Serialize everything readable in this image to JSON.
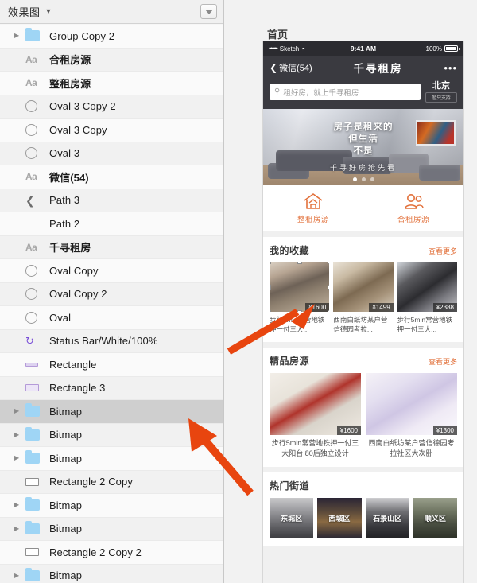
{
  "panel": {
    "title": "效果图",
    "chevron_icon": "chevron-down-icon",
    "filter_icon": "filter-dropdown-icon",
    "layers": [
      {
        "name": "Group Copy 2",
        "icon": "folder-icon",
        "arrow": true,
        "cjk": false
      },
      {
        "name": "合租房源",
        "icon": "text-icon",
        "arrow": false,
        "cjk": true
      },
      {
        "name": "整租房源",
        "icon": "text-icon",
        "arrow": false,
        "cjk": true
      },
      {
        "name": "Oval 3 Copy 2",
        "icon": "oval-icon",
        "arrow": false,
        "cjk": false
      },
      {
        "name": "Oval 3 Copy",
        "icon": "oval-icon",
        "arrow": false,
        "cjk": false
      },
      {
        "name": "Oval 3",
        "icon": "oval-icon",
        "arrow": false,
        "cjk": false
      },
      {
        "name": "微信(54)",
        "icon": "text-icon",
        "arrow": false,
        "cjk": true
      },
      {
        "name": "Path 3",
        "icon": "path-icon",
        "arrow": false,
        "cjk": false
      },
      {
        "name": "Path 2",
        "icon": "none",
        "arrow": false,
        "cjk": false
      },
      {
        "name": "千寻租房",
        "icon": "text-icon",
        "arrow": false,
        "cjk": true
      },
      {
        "name": "Oval Copy",
        "icon": "oval-icon",
        "arrow": false,
        "cjk": false
      },
      {
        "name": "Oval Copy 2",
        "icon": "oval-icon",
        "arrow": false,
        "cjk": false
      },
      {
        "name": "Oval",
        "icon": "oval-icon",
        "arrow": false,
        "cjk": false
      },
      {
        "name": "Status Bar/White/100%",
        "icon": "symbol-icon",
        "arrow": false,
        "cjk": false
      },
      {
        "name": "Rectangle",
        "icon": "rect-thin-icon",
        "arrow": false,
        "cjk": false
      },
      {
        "name": "Rectangle 3",
        "icon": "rect-mid-icon",
        "arrow": false,
        "cjk": false
      },
      {
        "name": "Bitmap",
        "icon": "folder-icon",
        "arrow": true,
        "cjk": false,
        "selected": true
      },
      {
        "name": "Bitmap",
        "icon": "folder-icon",
        "arrow": true,
        "cjk": false
      },
      {
        "name": "Bitmap",
        "icon": "folder-icon",
        "arrow": true,
        "cjk": false
      },
      {
        "name": "Rectangle 2 Copy",
        "icon": "rect-open-icon",
        "arrow": false,
        "cjk": false
      },
      {
        "name": "Bitmap",
        "icon": "folder-icon",
        "arrow": true,
        "cjk": false
      },
      {
        "name": "Bitmap",
        "icon": "folder-icon",
        "arrow": true,
        "cjk": false
      },
      {
        "name": "Rectangle 2 Copy 2",
        "icon": "rect-open-icon",
        "arrow": false,
        "cjk": false
      },
      {
        "name": "Bitmap",
        "icon": "folder-icon",
        "arrow": true,
        "cjk": false
      }
    ]
  },
  "canvas": {
    "artboard_label": "首页"
  },
  "phone": {
    "status_bar": {
      "signal_dots": "•••••",
      "carrier": "Sketch",
      "wifi_icon": "wifi-icon",
      "time": "9:41 AM",
      "battery_percent": "100%",
      "battery_icon": "battery-full-icon"
    },
    "nav": {
      "back_chevron_icon": "chevron-left-icon",
      "back_label": "微信(54)",
      "title": "千寻租房",
      "more_icon": "more-dots-icon",
      "more_label": "•••"
    },
    "search": {
      "icon": "search-icon",
      "placeholder": "租好房，就上千寻租房",
      "value": ""
    },
    "location": {
      "city": "北京",
      "badge": "暂只支持"
    },
    "hero": {
      "line1": "房子是租来的",
      "line2": "但生活",
      "line3": "不是",
      "sub": "千寻好房抢先看",
      "dots_total": 3,
      "dot_active": 1
    },
    "categories": [
      {
        "label": "整租房源",
        "icon": "house-icon"
      },
      {
        "label": "合租房源",
        "icon": "people-icon"
      }
    ],
    "favorites": {
      "title": "我的收藏",
      "more": "查看更多",
      "cards": [
        {
          "price": "¥1600",
          "caption": "步行5min常营地铁押一付三大...",
          "selected": true
        },
        {
          "price": "¥1499",
          "caption": "西南白纸坊某户营信德园考拉...",
          "selected": false
        },
        {
          "price": "¥2388",
          "caption": "步行5min常营地铁押一付三大...",
          "selected": false
        }
      ]
    },
    "premium": {
      "title": "精品房源",
      "more": "查看更多",
      "cards": [
        {
          "price": "¥1600",
          "caption": "步行5min常营地铁押一付三大阳台 80后独立设计"
        },
        {
          "price": "¥1300",
          "caption": "西南白纸坊某户营信德园考拉社区大次卧"
        }
      ]
    },
    "streets": {
      "title": "热门街道",
      "tiles": [
        {
          "label": "东城区"
        },
        {
          "label": "西城区"
        },
        {
          "label": "石景山区"
        },
        {
          "label": "顺义区"
        }
      ]
    }
  },
  "annotations": {
    "arrow_color": "#E8450F",
    "arrows": [
      {
        "name": "arrow-to-selected-card"
      },
      {
        "name": "arrow-to-selected-layer"
      }
    ]
  }
}
